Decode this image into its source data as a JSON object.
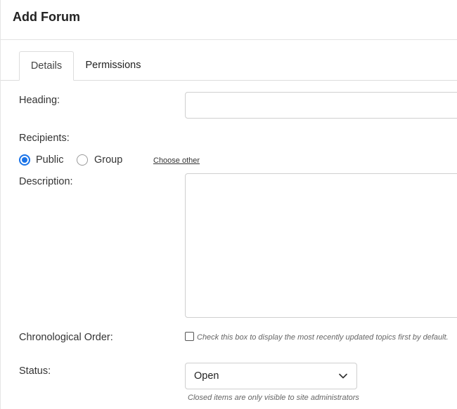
{
  "page": {
    "title": "Add Forum"
  },
  "tabs": [
    {
      "label": "Details",
      "active": true
    },
    {
      "label": "Permissions",
      "active": false
    }
  ],
  "form": {
    "heading": {
      "label": "Heading:",
      "value": ""
    },
    "recipients": {
      "label": "Recipients:",
      "options": [
        {
          "label": "Public",
          "selected": true
        },
        {
          "label": "Group",
          "selected": false
        }
      ],
      "choose_other_link": "Choose other"
    },
    "description": {
      "label": "Description:",
      "value": ""
    },
    "chronological_order": {
      "label": "Chronological Order:",
      "checked": false,
      "hint": "Check this box to display the most recently updated topics first by default."
    },
    "status": {
      "label": "Status:",
      "selected": "Open",
      "hint": "Closed items are only visible to site administrators"
    }
  },
  "colors": {
    "accent": "#1a73e8"
  },
  "icons": {
    "status_dropdown": "chevron-down-icon"
  }
}
